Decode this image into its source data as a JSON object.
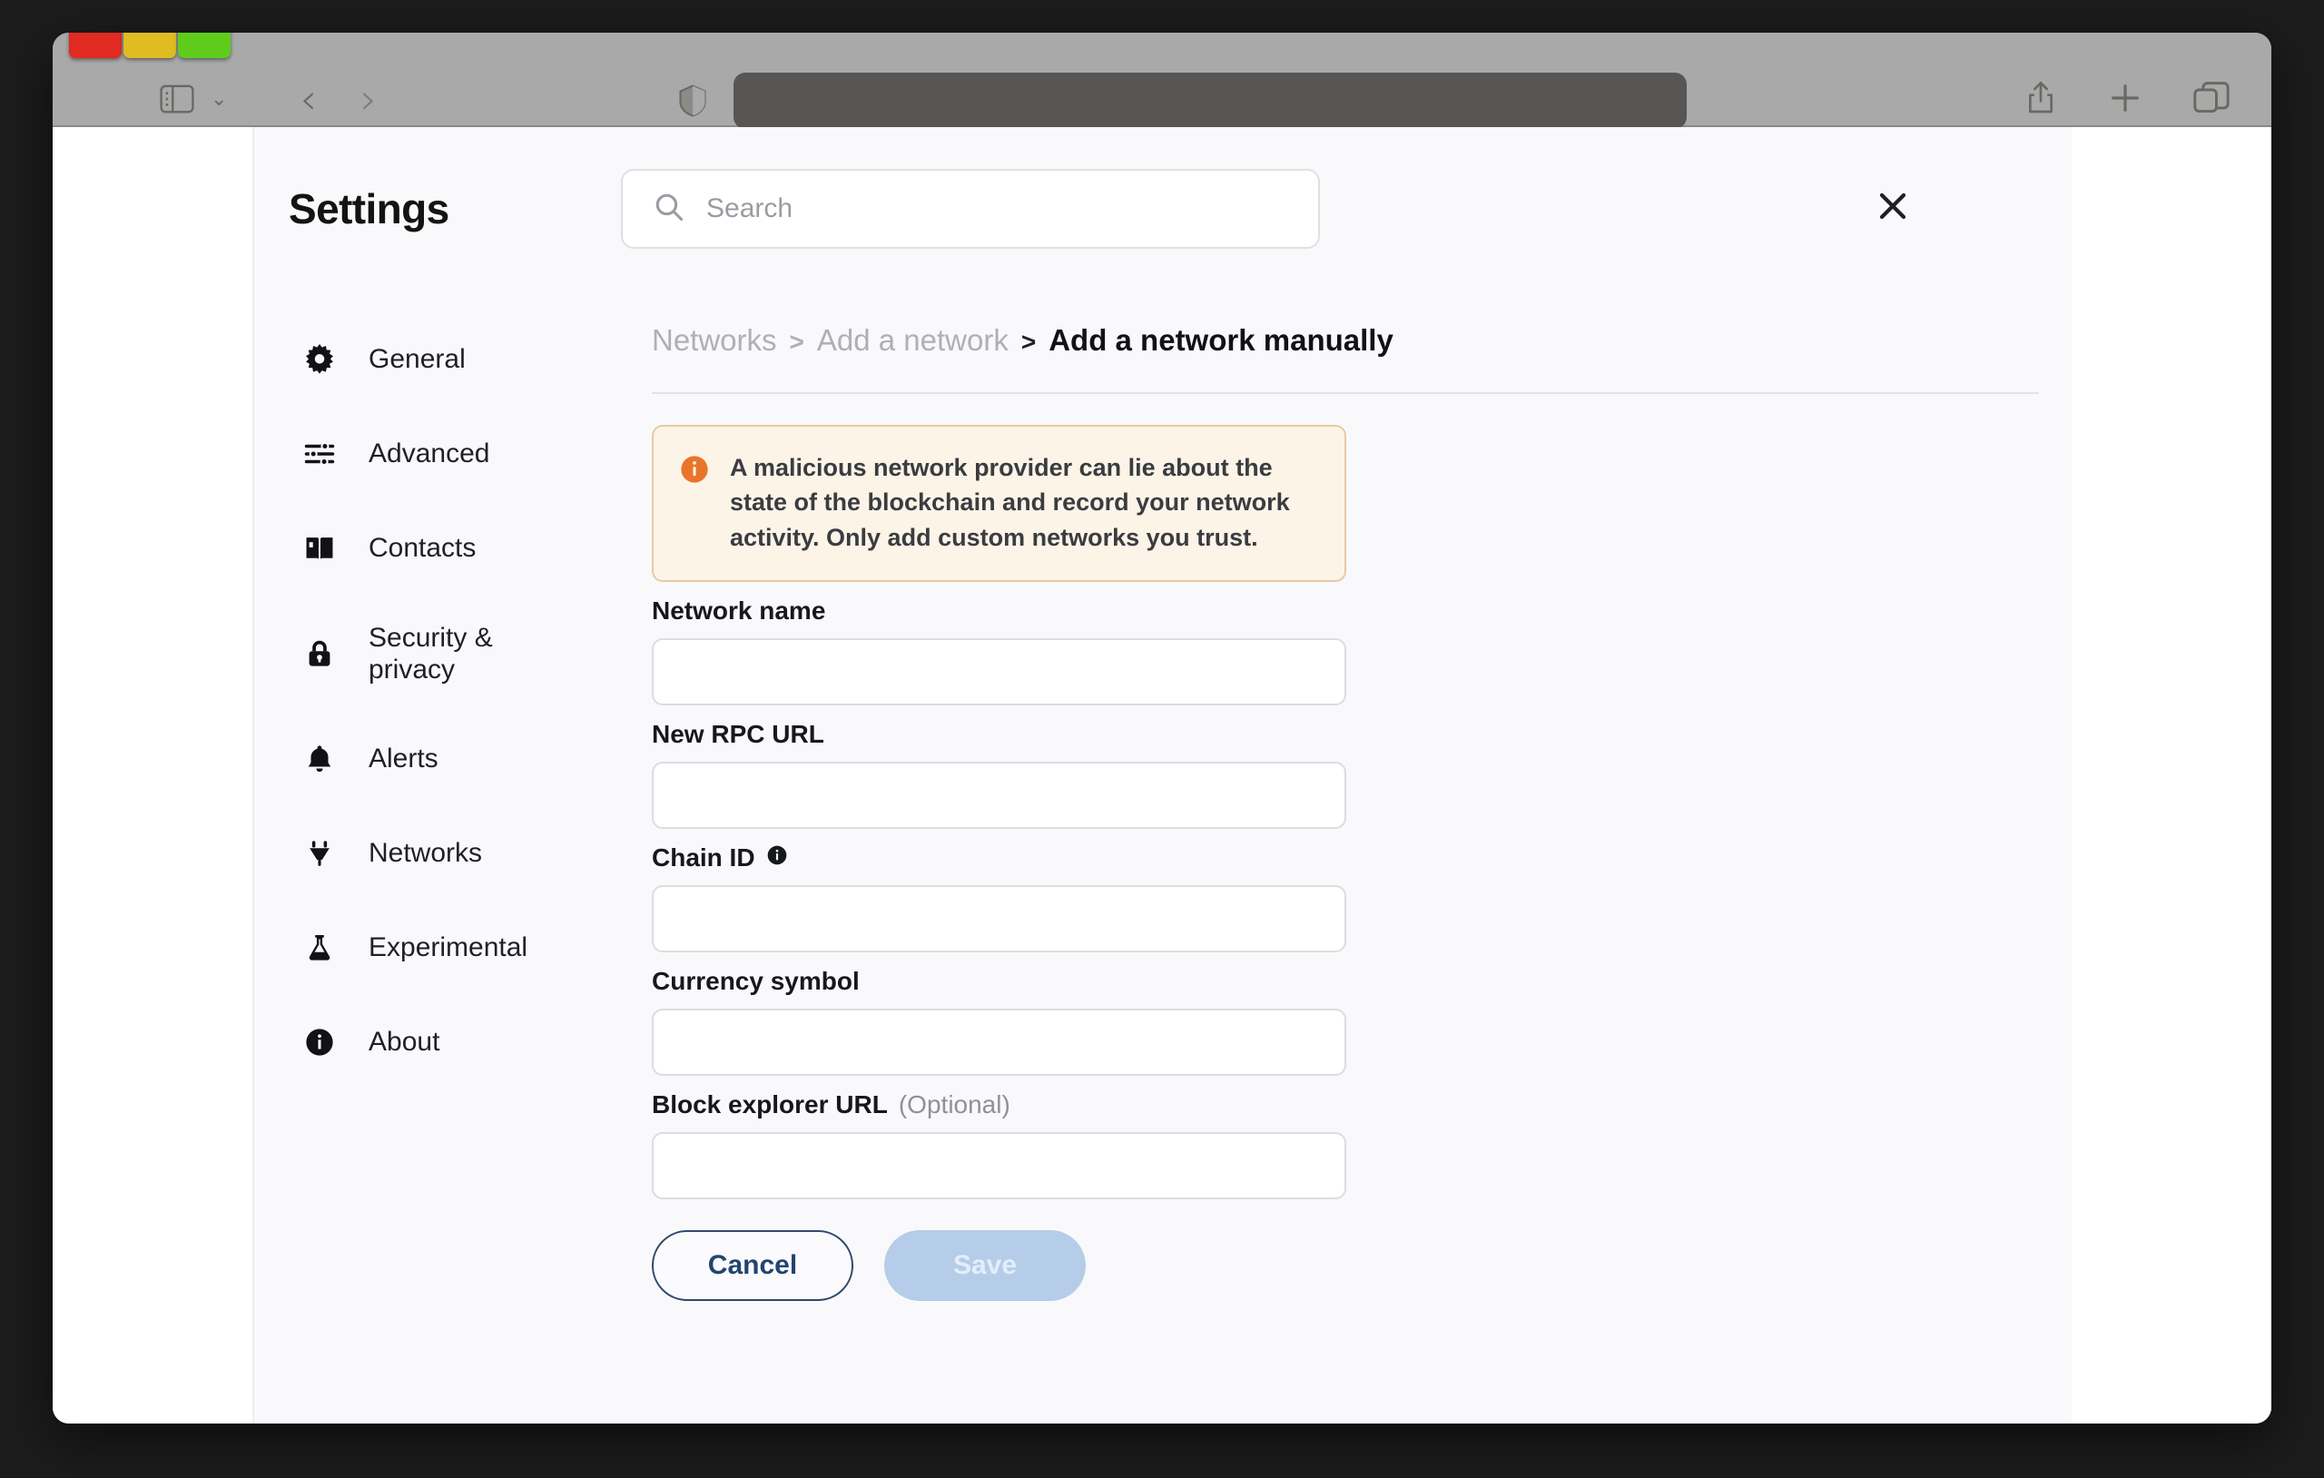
{
  "browser": {
    "window_controls": [
      "close",
      "minimize",
      "maximize"
    ],
    "sidebar_toggle_icon": "sidebar-icon",
    "sidebar_dropdown_icon": "chevron-down-icon",
    "back_icon": "chevron-left-icon",
    "forward_icon": "chevron-right-icon",
    "shield_icon": "shield-icon",
    "url_value": "",
    "share_icon": "share-icon",
    "new_tab_icon": "plus-icon",
    "tabs_icon": "tab-overview-icon"
  },
  "settings": {
    "title": "Settings",
    "search": {
      "placeholder": "Search",
      "value": "",
      "icon": "search-icon"
    },
    "close_icon": "close-icon"
  },
  "sidebar": {
    "items": [
      {
        "label": "General",
        "icon": "gear-icon"
      },
      {
        "label": "Advanced",
        "icon": "sliders-icon"
      },
      {
        "label": "Contacts",
        "icon": "book-icon"
      },
      {
        "label": "Security & privacy",
        "icon": "lock-icon"
      },
      {
        "label": "Alerts",
        "icon": "bell-icon"
      },
      {
        "label": "Networks",
        "icon": "plug-icon"
      },
      {
        "label": "Experimental",
        "icon": "flask-icon"
      },
      {
        "label": "About",
        "icon": "info-icon"
      }
    ]
  },
  "breadcrumb": {
    "root": "Networks",
    "separator": ">",
    "parent": "Add a network",
    "current": "Add a network manually"
  },
  "warning": {
    "icon": "warning-info-icon",
    "text": "A malicious network provider can lie about the state of the blockchain and record your network activity. Only add custom networks you trust.",
    "background": "#fdf4e8",
    "border": "#e8c9a4",
    "icon_color": "#e8752a"
  },
  "form": {
    "fields": [
      {
        "label": "Network name",
        "value": "",
        "optional": "",
        "info_icon": false
      },
      {
        "label": "New RPC URL",
        "value": "",
        "optional": "",
        "info_icon": false
      },
      {
        "label": "Chain ID",
        "value": "",
        "optional": "",
        "info_icon": true
      },
      {
        "label": "Currency symbol",
        "value": "",
        "optional": "",
        "info_icon": false
      },
      {
        "label": "Block explorer URL",
        "value": "",
        "optional": "(Optional)",
        "info_icon": false
      }
    ],
    "cancel_label": "Cancel",
    "save_label": "Save",
    "save_disabled": true,
    "cancel_color": "#22456f",
    "save_background": "#b5cde8"
  }
}
